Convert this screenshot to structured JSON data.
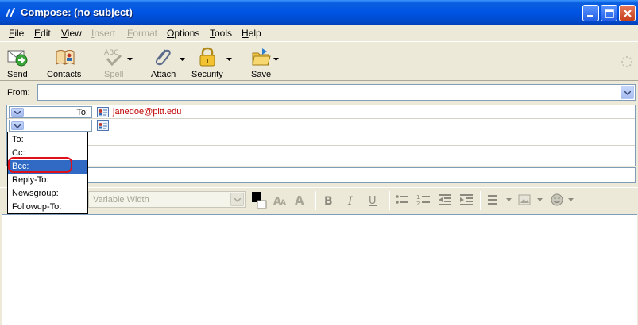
{
  "window": {
    "title": "Compose: (no subject)"
  },
  "menu": [
    {
      "label": "File",
      "key": "F",
      "rest": "ile",
      "enabled": true
    },
    {
      "label": "Edit",
      "key": "E",
      "rest": "dit",
      "enabled": true
    },
    {
      "label": "View",
      "key": "V",
      "rest": "iew",
      "enabled": true
    },
    {
      "label": "Insert",
      "key": "I",
      "rest": "nsert",
      "enabled": false
    },
    {
      "label": "Format",
      "key": "F",
      "rest": "ormat",
      "enabled": false
    },
    {
      "label": "Options",
      "key": "O",
      "rest": "ptions",
      "enabled": true
    },
    {
      "label": "Tools",
      "key": "T",
      "rest": "ools",
      "enabled": true
    },
    {
      "label": "Help",
      "key": "H",
      "rest": "elp",
      "enabled": true
    }
  ],
  "toolbar": {
    "send": "Send",
    "contacts": "Contacts",
    "spell": "Spell",
    "attach": "Attach",
    "security": "Security",
    "save": "Save"
  },
  "from": {
    "label": "From:",
    "value": ""
  },
  "addressing": {
    "rows": [
      {
        "type": "To:",
        "address": "janedoe@pitt.edu"
      },
      {
        "type": "",
        "address": ""
      }
    ],
    "dropdown_options": [
      "To:",
      "Cc:",
      "Bcc:",
      "Reply-To:",
      "Newsgroup:",
      "Followup-To:"
    ],
    "selected_option": "Bcc:"
  },
  "subject": {
    "value": ""
  },
  "format": {
    "font": "Variable Width"
  },
  "colors": {
    "accent": "#316ac5",
    "highlight_ring": "#e0101a",
    "address_text": "#c00000"
  }
}
